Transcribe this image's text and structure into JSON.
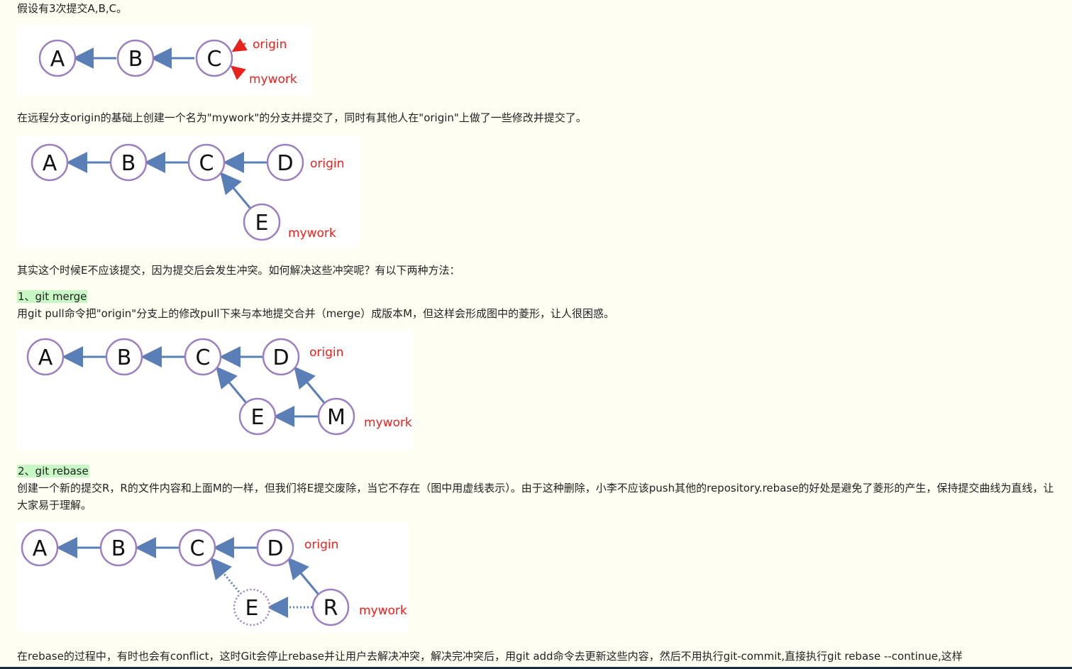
{
  "text": {
    "p1": "假设有3次提交A,B,C。",
    "p2": "在远程分支origin的基础上创建一个名为\"mywork\"的分支并提交了，同时有其他人在\"origin\"上做了一些修改并提交了。",
    "p3": "其实这个时候E不应该提交，因为提交后会发生冲突。如何解决这些冲突呢？有以下两种方法：",
    "h1": "1、git merge",
    "p4": "用git pull命令把\"origin\"分支上的修改pull下来与本地提交合并（merge）成版本M，但这样会形成图中的菱形，让人很困惑。",
    "h2": "2、git rebase",
    "p5": "创建一个新的提交R，R的文件内容和上面M的一样，但我们将E提交废除，当它不存在（图中用虚线表示）。由于这种删除，小李不应该push其他的repository.rebase的好处是避免了菱形的产生，保持提交曲线为直线，让大家易于理解。",
    "p6": "在rebase的过程中，有时也会有conflict，这时Git会停止rebase并让用户去解决冲突，解决完冲突后，用git add命令去更新这些内容，然后不用执行git-commit,直接执行git rebase --continue,这样"
  },
  "diagrams": {
    "d1": {
      "nodes": [
        "A",
        "B",
        "C"
      ],
      "refs": [
        "origin",
        "mywork"
      ]
    },
    "d2": {
      "nodes": [
        "A",
        "B",
        "C",
        "D",
        "E"
      ],
      "refs": [
        "origin",
        "mywork"
      ]
    },
    "d3": {
      "nodes": [
        "A",
        "B",
        "C",
        "D",
        "E",
        "M"
      ],
      "refs": [
        "origin",
        "mywork"
      ]
    },
    "d4": {
      "nodes": [
        "A",
        "B",
        "C",
        "D",
        "E",
        "R"
      ],
      "refs": [
        "origin",
        "mywork"
      ]
    }
  },
  "colors": {
    "node_stroke": "#9b7fc0",
    "edge": "#5a7fb7",
    "ref_label": "#e8231e",
    "highlight": "#c8f7c5"
  }
}
